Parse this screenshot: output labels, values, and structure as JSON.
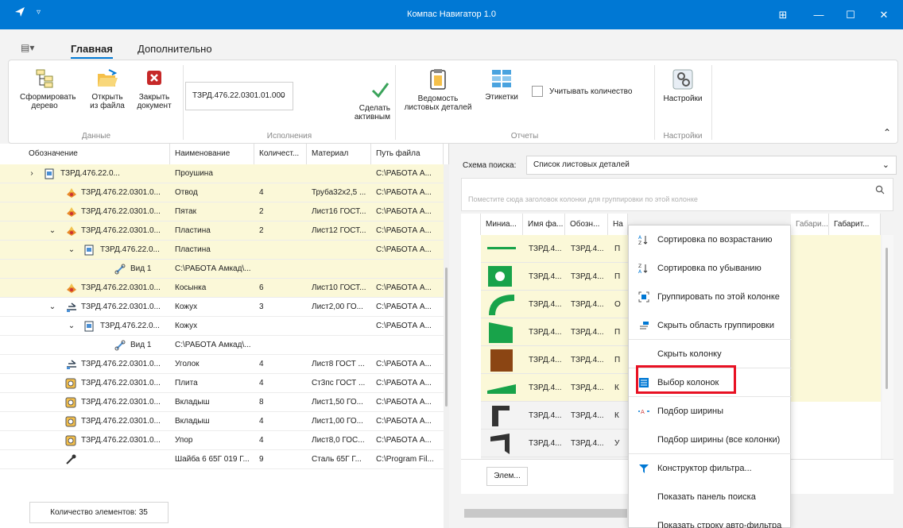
{
  "window": {
    "title": "Компас Навигатор 1.0"
  },
  "ribbon": {
    "tabs": [
      "Главная",
      "Дополнительно"
    ],
    "buttons": {
      "form_tree": "Сформировать\nдерево",
      "open_file": "Открыть\nиз файла",
      "close_doc": "Закрыть\nдокумент",
      "make_active": "Сделать\nактивным",
      "sheet_list": "Ведомость\nлистовых деталей",
      "labels": "Этикетки",
      "settings": "Настройки"
    },
    "doc_select": "ТЗРД.476.22.0301.01.000",
    "count_checkbox": "Учитывать количество",
    "groups": [
      "Данные",
      "Исполнения",
      "Отчеты",
      "Настройки"
    ]
  },
  "tree": {
    "columns": [
      "Обозначение",
      "Наименование",
      "Количест...",
      "Материал",
      "Путь файла"
    ],
    "rows": [
      {
        "designation": "ТЗРД.476.22.0...",
        "name": "Проушина",
        "qty": "",
        "material": "",
        "path": "C:\\РАБОТА А...",
        "hl": true,
        "indent": 56,
        "icon": "doc",
        "exp": ">"
      },
      {
        "designation": "ТЗРД.476.22.0301.0...",
        "name": "Отвод",
        "qty": "4",
        "material": "Труба32х2,5 ...",
        "path": "C:\\РАБОТА А...",
        "hl": true,
        "indent": 82,
        "icon": "sheet",
        "exp": ""
      },
      {
        "designation": "ТЗРД.476.22.0301.0...",
        "name": "Пятак",
        "qty": "2",
        "material": "Лист16 ГОСТ...",
        "path": "C:\\РАБОТА А...",
        "hl": true,
        "indent": 82,
        "icon": "sheet",
        "exp": ""
      },
      {
        "designation": "ТЗРД.476.22.0301.0...",
        "name": "Пластина",
        "qty": "2",
        "material": "Лист12 ГОСТ...",
        "path": "C:\\РАБОТА А...",
        "hl": true,
        "indent": 82,
        "icon": "sheet",
        "exp": "v"
      },
      {
        "designation": "ТЗРД.476.22.0...",
        "name": "Пластина",
        "qty": "",
        "material": "",
        "path": "C:\\РАБОТА А...",
        "hl": true,
        "indent": 106,
        "icon": "doc",
        "exp": "v"
      },
      {
        "designation": "Вид 1",
        "name": "C:\\РАБОТА Амкад\\...",
        "qty": "",
        "material": "",
        "path": "",
        "hl": true,
        "indent": 144,
        "icon": "link",
        "exp": ""
      },
      {
        "designation": "ТЗРД.476.22.0301.0...",
        "name": "Косынка",
        "qty": "6",
        "material": "Лист10 ГОСТ...",
        "path": "C:\\РАБОТА А...",
        "hl": true,
        "indent": 82,
        "icon": "sheet",
        "exp": ""
      },
      {
        "designation": "ТЗРД.476.22.0301.0...",
        "name": "Кожух",
        "qty": "3",
        "material": "Лист2,00 ГО...",
        "path": "C:\\РАБОТА А...",
        "hl": false,
        "indent": 82,
        "icon": "asm",
        "exp": "v"
      },
      {
        "designation": "ТЗРД.476.22.0...",
        "name": "Кожух",
        "qty": "",
        "material": "",
        "path": "C:\\РАБОТА А...",
        "hl": false,
        "indent": 106,
        "icon": "doc",
        "exp": "v"
      },
      {
        "designation": "Вид 1",
        "name": "C:\\РАБОТА Амкад\\...",
        "qty": "",
        "material": "",
        "path": "",
        "hl": false,
        "indent": 144,
        "icon": "link",
        "exp": ""
      },
      {
        "designation": "ТЗРД.476.22.0301.0...",
        "name": "Уголок",
        "qty": "4",
        "material": "Лист8 ГОСТ ...",
        "path": "C:\\РАБОТА А...",
        "hl": false,
        "indent": 82,
        "icon": "asm",
        "exp": ""
      },
      {
        "designation": "ТЗРД.476.22.0301.0...",
        "name": "Плита",
        "qty": "4",
        "material": "Ст3пс ГОСТ ...",
        "path": "C:\\РАБОТА А...",
        "hl": false,
        "indent": 82,
        "icon": "part",
        "exp": ""
      },
      {
        "designation": "ТЗРД.476.22.0301.0...",
        "name": "Вкладыш",
        "qty": "8",
        "material": "Лист1,50 ГО...",
        "path": "C:\\РАБОТА А...",
        "hl": false,
        "indent": 82,
        "icon": "part",
        "exp": ""
      },
      {
        "designation": "ТЗРД.476.22.0301.0...",
        "name": "Вкладыш",
        "qty": "4",
        "material": "Лист1,00 ГО...",
        "path": "C:\\РАБОТА А...",
        "hl": false,
        "indent": 82,
        "icon": "part",
        "exp": ""
      },
      {
        "designation": "ТЗРД.476.22.0301.0...",
        "name": "Упор",
        "qty": "4",
        "material": "Лист8,0 ГОС...",
        "path": "C:\\РАБОТА А...",
        "hl": false,
        "indent": 82,
        "icon": "part",
        "exp": ""
      },
      {
        "designation": "",
        "name": "Шайба 6 65Г 019 Г...",
        "qty": "9",
        "material": "Сталь 65Г Г...",
        "path": "C:\\Program Fil...",
        "hl": false,
        "indent": 82,
        "icon": "std",
        "exp": ""
      }
    ],
    "count_label": "Количество элементов: 35"
  },
  "right": {
    "schema_label": "Схема поиска:",
    "schema_value": "Список листовых деталей",
    "group_hint": "Поместите сюда заголовок колонки для группировки по этой колонке",
    "columns": [
      "Миниа...",
      "Имя фа...",
      "Обозн...",
      "На",
      "Габари...",
      "Габарит..."
    ],
    "rows": [
      {
        "name": "ТЗРД.4...",
        "desig": "ТЗРД.4...",
        "nm": "П",
        "hl": true,
        "thumb": "line",
        "tc": "#18a34a"
      },
      {
        "name": "ТЗРД.4...",
        "desig": "ТЗРД.4...",
        "nm": "П",
        "hl": true,
        "thumb": "circle",
        "tc": "#18a34a"
      },
      {
        "name": "ТЗРД.4...",
        "desig": "ТЗРД.4...",
        "nm": "О",
        "hl": true,
        "thumb": "arc",
        "tc": "#18a34a"
      },
      {
        "name": "ТЗРД.4...",
        "desig": "ТЗРД.4...",
        "nm": "П",
        "hl": true,
        "thumb": "trap",
        "tc": "#18a34a"
      },
      {
        "name": "ТЗРД.4...",
        "desig": "ТЗРД.4...",
        "nm": "П",
        "hl": true,
        "thumb": "square",
        "tc": "#8b4513"
      },
      {
        "name": "ТЗРД.4...",
        "desig": "ТЗРД.4...",
        "nm": "К",
        "hl": true,
        "thumb": "wedge",
        "tc": "#18a34a"
      },
      {
        "name": "ТЗРД.4...",
        "desig": "ТЗРД.4...",
        "nm": "К",
        "hl": false,
        "thumb": "bracket",
        "tc": "#333333"
      },
      {
        "name": "ТЗРД.4...",
        "desig": "ТЗРД.4...",
        "nm": "У",
        "hl": false,
        "thumb": "angle",
        "tc": "#333333"
      }
    ],
    "footer_btn": "Элем..."
  },
  "menu": {
    "items": [
      {
        "label": "Сортировка по возрастанию",
        "icon": "sort-asc-icon"
      },
      {
        "label": "Сортировка по убыванию",
        "icon": "sort-desc-icon"
      },
      {
        "label": "Группировать по этой колонке",
        "icon": "group-icon"
      },
      {
        "label": "Скрыть область группировки",
        "icon": "hide-group-icon"
      },
      {
        "label": "Скрыть колонку",
        "icon": ""
      },
      {
        "label": "Выбор колонок",
        "icon": "columns-icon"
      },
      {
        "label": "Подбор ширины",
        "icon": "fit-width-icon"
      },
      {
        "label": "Подбор ширины (все колонки)",
        "icon": ""
      },
      {
        "label": "Конструктор фильтра...",
        "icon": "filter-icon"
      },
      {
        "label": "Показать панель поиска",
        "icon": ""
      },
      {
        "label": "Показать строку авто-фильтра",
        "icon": ""
      }
    ]
  },
  "colors": {
    "accent": "#0078d4",
    "highlight_row": "#fbf8d8",
    "annotation": "#e81123"
  }
}
